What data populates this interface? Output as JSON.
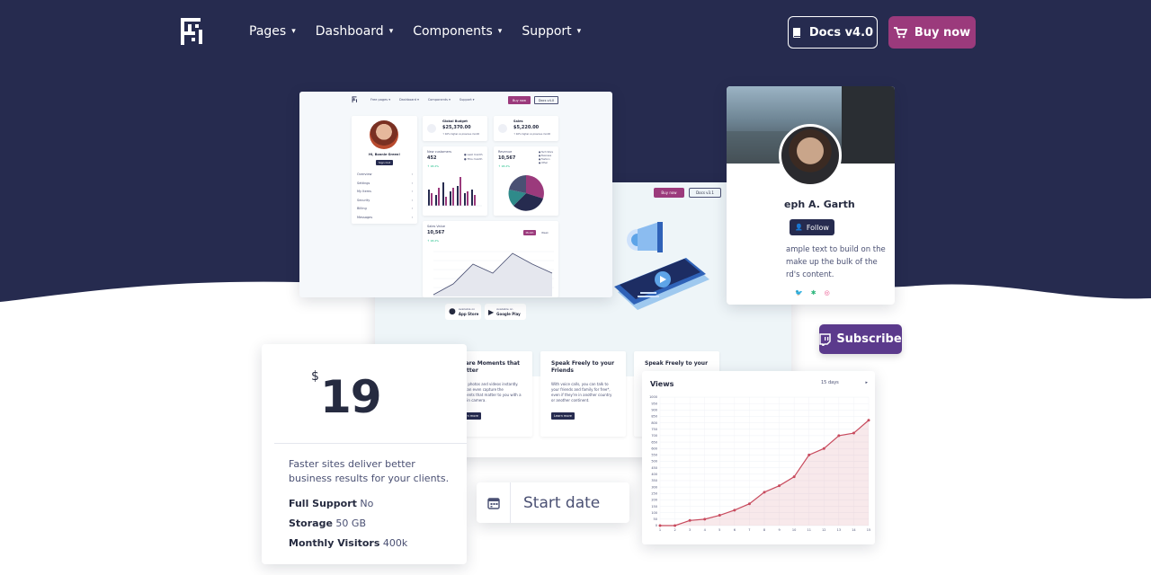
{
  "colors": {
    "hero": "#262b4f",
    "accent": "#9b3a7c",
    "twitch": "#5b3a8c",
    "chart_line": "#c84b5e"
  },
  "nav": {
    "items": [
      {
        "label": "Pages",
        "icon": "chevron-down-icon"
      },
      {
        "label": "Dashboard",
        "icon": "chevron-down-icon"
      },
      {
        "label": "Components",
        "icon": "chevron-down-icon"
      },
      {
        "label": "Support",
        "icon": "chevron-down-icon"
      }
    ],
    "docs_label": "Docs v4.0",
    "buy_label": "Buy now"
  },
  "dashboard": {
    "nav": [
      "Free pages ▾",
      "Dashboard ▾",
      "Components ▾",
      "Support ▾"
    ],
    "buy": "Buy now",
    "docs": "Docs v4.0",
    "user_name": "Hi, Bonnie Green!",
    "signout": "Sign Out",
    "menu": [
      "Overview",
      "Settings",
      "My Items",
      "Security",
      "Billing",
      "Messages"
    ],
    "global_budget": {
      "title": "Global Budget",
      "value": "$25,370.00",
      "note": "↑ 40% higher vs previous month"
    },
    "sales": {
      "title": "Sales",
      "value": "$5,220.00",
      "note": "↑ 40% higher vs previous month"
    },
    "new_customers": {
      "title": "New customers",
      "value": "452",
      "change": "↑ 18.2%",
      "legend": [
        "Last month",
        "This month"
      ]
    },
    "revenue": {
      "title": "Revenue",
      "value": "10,567",
      "change": "↑ 18.2%",
      "legend": [
        "Tech Store",
        "Business",
        "Fashion",
        "Other"
      ]
    },
    "sales_value": {
      "title": "Sales Value",
      "value": "10,567",
      "change": "↑ 18.2%",
      "toggle": [
        "Month",
        "Week"
      ]
    }
  },
  "app": {
    "buy": "Buy now",
    "docs": "Docs v3.1",
    "store_badges": [
      {
        "small": "Available on",
        "big": "App Store"
      },
      {
        "small": "Available on",
        "big": "Google Play"
      }
    ],
    "features": [
      {
        "title": "Share Moments that Matter",
        "text": "Send photos and videos instantly. You can even capture the moments that matter to you with a built-in camera.",
        "btn": "Learn more"
      },
      {
        "title": "Speak Freely to your Friends",
        "text": "With voice calls, you can talk to your friends and family for free*, even if they're in another country or another continent.",
        "btn": "Learn more"
      },
      {
        "title": "Speak Freely to your",
        "text": "",
        "btn": ""
      }
    ]
  },
  "profile": {
    "name": "eph A. Garth",
    "follow": "Follow",
    "bio": [
      "ample text to build on the",
      "make up the bulk of the",
      "rd's content."
    ]
  },
  "subscribe": {
    "label": "Subscribe"
  },
  "pricing": {
    "currency": "$",
    "amount": "19",
    "description": "Faster sites deliver better business results for your clients.",
    "features": [
      {
        "name": "Full Support",
        "value": "No"
      },
      {
        "name": "Storage",
        "value": "50 GB"
      },
      {
        "name": "Monthly Visitors",
        "value": "400k"
      }
    ]
  },
  "date": {
    "placeholder": "Start date"
  },
  "views": {
    "title": "Views",
    "range": "15 days"
  },
  "chart_data": {
    "type": "area",
    "title": "Views",
    "x": [
      1,
      2,
      3,
      4,
      5,
      6,
      7,
      8,
      9,
      10,
      11,
      12,
      13,
      14,
      15
    ],
    "values": [
      0,
      0,
      40,
      50,
      80,
      120,
      170,
      260,
      310,
      380,
      550,
      600,
      700,
      720,
      820
    ],
    "ylim": [
      0,
      1000
    ],
    "yticks": [
      0,
      50,
      100,
      150,
      200,
      250,
      300,
      350,
      400,
      450,
      500,
      550,
      600,
      650,
      700,
      750,
      800,
      850,
      900,
      950,
      1000
    ],
    "grid": true
  }
}
